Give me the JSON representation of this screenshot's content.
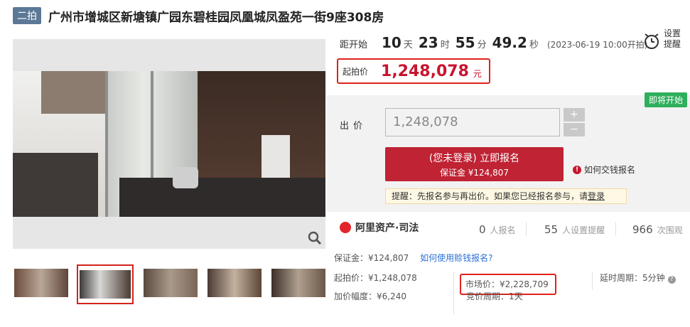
{
  "header": {
    "tag": "二拍",
    "title": "广州市增城区新塘镇广园东碧桂园凤凰城凤盈苑一街9座308房"
  },
  "countdown": {
    "label": "距开始",
    "days": "10",
    "days_unit": "天",
    "hours": "23",
    "hours_unit": "时",
    "minutes": "55",
    "minutes_unit": "分",
    "seconds": "49.2",
    "seconds_unit": "秒",
    "start_text": "(2023-06-19 10:00开拍)"
  },
  "reminder": {
    "label": "设置提醒"
  },
  "start_price": {
    "label": "起拍价",
    "value": "1,248,078",
    "unit": "元"
  },
  "bid_panel": {
    "badge": "即将开始",
    "bid_label": "出价",
    "bid_value": "1,248,078",
    "plus": "+",
    "minus": "−",
    "signup_line1": "(您未登录) 立即报名",
    "signup_line2": "保证金 ¥124,807",
    "howto": "如何交钱报名",
    "tip_text": "提醒：先报名参与再出价。如果您已经报名参与，请",
    "tip_login": "登录"
  },
  "stats": {
    "brand": "阿里资产·司法",
    "signups_num": "0",
    "signups_label": "人报名",
    "reminders_num": "55",
    "reminders_label": "人设置提醒",
    "views_num": "966",
    "views_label": "次围观"
  },
  "info": {
    "deposit": "保证金：¥124,807",
    "deposit_link": "如何使用赊钱报名?",
    "start_price": "起拍价：¥1,248,078",
    "market_price": "市场价：¥2,228,709",
    "delay": "延时周期：5分钟",
    "increment": "加价幅度：¥6,240",
    "bid_cycle": "竞价周期：1天"
  },
  "colors": {
    "accent": "#c8152d",
    "badge": "#2eaf5c",
    "tag": "#5c7897"
  }
}
